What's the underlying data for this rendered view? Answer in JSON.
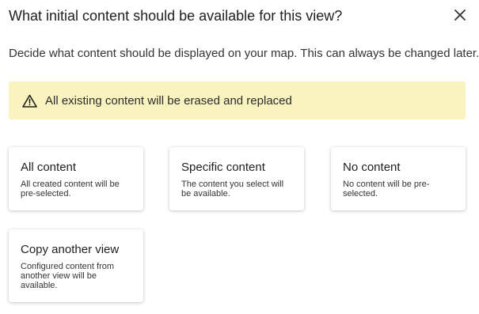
{
  "dialog": {
    "title": "What initial content should be available for this view?",
    "subtitle": "Decide what content should be displayed on your map. This can always be changed later.",
    "close_icon": "close-icon"
  },
  "warning": {
    "icon": "warning-triangle-icon",
    "text": "All existing content will be erased and replaced",
    "background": "#fbf3bf"
  },
  "options": [
    {
      "title": "All content",
      "description": "All created content will be pre-selected."
    },
    {
      "title": "Specific content",
      "description": "The content you select will be available."
    },
    {
      "title": "No content",
      "description": "No content will be pre-selected."
    },
    {
      "title": "Copy another view",
      "description": "Configured content from another view will be available."
    }
  ]
}
